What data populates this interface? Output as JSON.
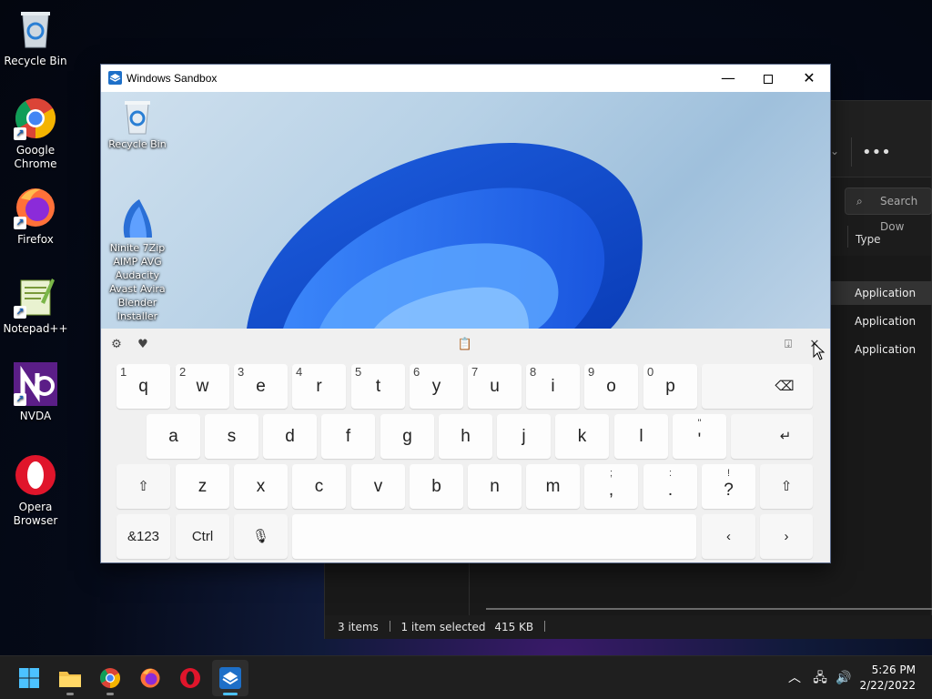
{
  "desktop": {
    "icons": [
      {
        "label": "Recycle Bin"
      },
      {
        "label": "Google Chrome"
      },
      {
        "label": "Firefox"
      },
      {
        "label": "Notepad++"
      },
      {
        "label": "NVDA"
      },
      {
        "label": "Opera Browser"
      }
    ]
  },
  "explorer": {
    "search_placeholder": "Search Dow",
    "column_type": "Type",
    "rows": [
      "Application",
      "Application",
      "Application"
    ],
    "status": {
      "items": "3 items",
      "selected": "1 item selected",
      "size": "415 KB"
    }
  },
  "sandbox": {
    "title": "Windows Sandbox",
    "desktop_icons": [
      {
        "label": "Recycle Bin"
      },
      {
        "label": "Ninite 7Zip AIMP AVG Audacity Avast Avira Blender Installer"
      }
    ]
  },
  "keyboard": {
    "row1": [
      {
        "key": "q",
        "hint": "1"
      },
      {
        "key": "w",
        "hint": "2"
      },
      {
        "key": "e",
        "hint": "3"
      },
      {
        "key": "r",
        "hint": "4"
      },
      {
        "key": "t",
        "hint": "5"
      },
      {
        "key": "y",
        "hint": "6"
      },
      {
        "key": "u",
        "hint": "7"
      },
      {
        "key": "i",
        "hint": "8"
      },
      {
        "key": "o",
        "hint": "9"
      },
      {
        "key": "p",
        "hint": "0"
      }
    ],
    "row2": [
      {
        "key": "a"
      },
      {
        "key": "s"
      },
      {
        "key": "d"
      },
      {
        "key": "f"
      },
      {
        "key": "g"
      },
      {
        "key": "h"
      },
      {
        "key": "j"
      },
      {
        "key": "k"
      },
      {
        "key": "l"
      },
      {
        "key": "'",
        "top": "\""
      }
    ],
    "row3": [
      {
        "key": "z"
      },
      {
        "key": "x"
      },
      {
        "key": "c"
      },
      {
        "key": "v"
      },
      {
        "key": "b"
      },
      {
        "key": "n"
      },
      {
        "key": "m"
      },
      {
        "key": ",",
        "top": ";"
      },
      {
        "key": ".",
        "top": ":"
      },
      {
        "key": "?",
        "top": "!"
      }
    ],
    "numbers_label": "&123",
    "ctrl_label": "Ctrl"
  },
  "taskbar": {
    "time": "5:26 PM",
    "date": "2/22/2022"
  }
}
